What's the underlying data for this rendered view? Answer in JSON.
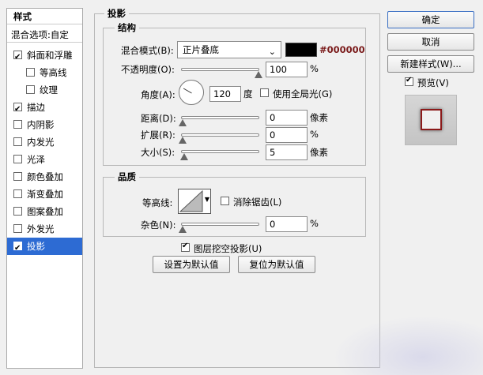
{
  "style_list": {
    "title": "样式",
    "blend_options": "混合选项:自定",
    "items": [
      {
        "label": "斜面和浮雕",
        "checked": true,
        "sub": false
      },
      {
        "label": "等高线",
        "checked": false,
        "sub": true
      },
      {
        "label": "纹理",
        "checked": false,
        "sub": true
      },
      {
        "label": "描边",
        "checked": true,
        "sub": false
      },
      {
        "label": "内阴影",
        "checked": false,
        "sub": false
      },
      {
        "label": "内发光",
        "checked": false,
        "sub": false
      },
      {
        "label": "光泽",
        "checked": false,
        "sub": false
      },
      {
        "label": "颜色叠加",
        "checked": false,
        "sub": false
      },
      {
        "label": "渐变叠加",
        "checked": false,
        "sub": false
      },
      {
        "label": "图案叠加",
        "checked": false,
        "sub": false
      },
      {
        "label": "外发光",
        "checked": false,
        "sub": false
      },
      {
        "label": "投影",
        "checked": true,
        "sub": false,
        "active": true
      }
    ]
  },
  "shadow": {
    "title": "投影",
    "structure": {
      "title": "结构",
      "blend_mode_label": "混合模式(B):",
      "blend_mode_value": "正片叠底",
      "color_hex": "#000000",
      "color_swatch": "#000000",
      "opacity_label": "不透明度(O):",
      "opacity_value": "100",
      "opacity_unit": "%",
      "angle_label": "角度(A):",
      "angle_value": "120",
      "angle_unit": "度",
      "global_light_label": "使用全局光(G)",
      "global_light_checked": false,
      "distance_label": "距离(D):",
      "distance_value": "0",
      "distance_unit": "像素",
      "spread_label": "扩展(R):",
      "spread_value": "0",
      "spread_unit": "%",
      "size_label": "大小(S):",
      "size_value": "5",
      "size_unit": "像素"
    },
    "quality": {
      "title": "品质",
      "contour_label": "等高线:",
      "antialias_label": "消除锯齿(L)",
      "antialias_checked": false,
      "noise_label": "杂色(N):",
      "noise_value": "0",
      "noise_unit": "%"
    },
    "knockout_label": "图层挖空投影(U)",
    "knockout_checked": true,
    "set_default_label": "设置为默认值",
    "reset_default_label": "复位为默认值"
  },
  "actions": {
    "ok_label": "确定",
    "cancel_label": "取消",
    "new_style_label": "新建样式(W)...",
    "preview_label": "预览(V)",
    "preview_checked": true
  },
  "colors": {
    "accent": "#2d6bd3",
    "hex_text": "#7a1a1a",
    "preview_stroke": "#8b1a1a"
  }
}
